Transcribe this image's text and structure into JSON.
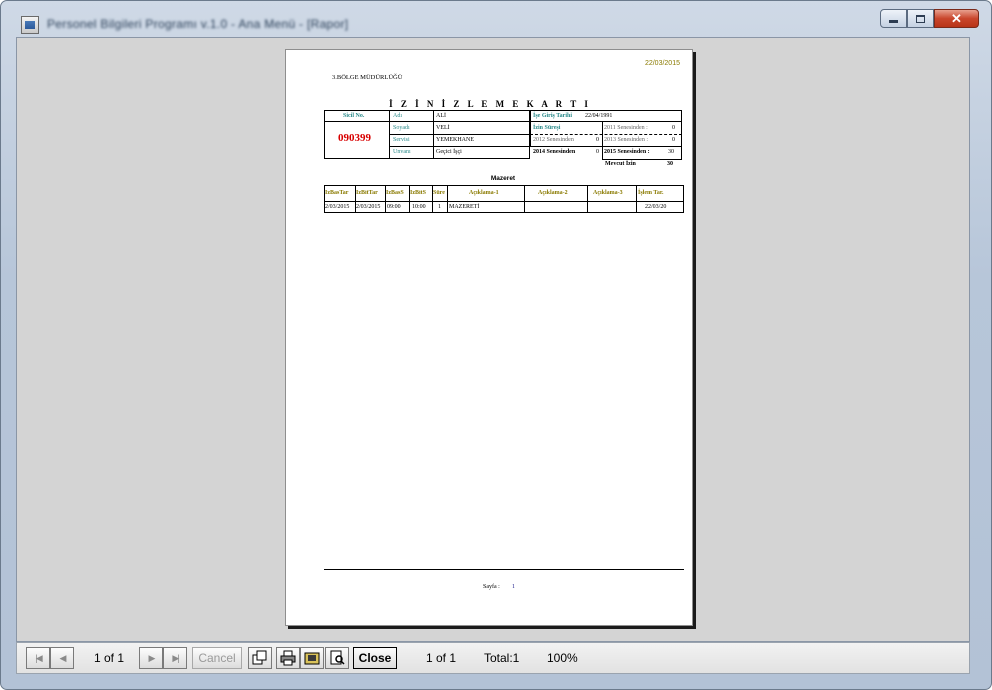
{
  "window": {
    "title": "Personel Bilgileri Programı v.1.0 - Ana Menü - [Rapor]",
    "controls": {
      "minimize": "minimize",
      "maximize": "maximize",
      "close": "✕"
    }
  },
  "report": {
    "date": "22/03/2015",
    "org": "3.BÖLGE MÜDÜRLÜĞÜ",
    "title": "İ Z İ N   İ Z L E M E   K A R T I",
    "card": {
      "sicil_label": "Sicil No.",
      "sicil_value": "090399",
      "adi_label": "Adı",
      "adi_value": "ALİ",
      "soyadi_label": "Soyadı",
      "soyadi_value": "VELİ",
      "servisi_label": "Servisi",
      "servisi_value": "YEMEKHANE",
      "unvani_label": "Unvanı",
      "unvani_value": "Geçici İşçi",
      "ise_giris_label": "İşe Giriş Tarihi",
      "ise_giris_value": "22/04/1991",
      "izin_suresi_label": "İzin Süreşi",
      "y2011_label": "2011 Senesinden :",
      "y2011_value": "0",
      "y2012_label": "2012 Senesinden",
      "y2012_value": "0",
      "y2013_label": "2013 Senesinden :",
      "y2013_value": "0",
      "y2014_label": "2014 Senesinden",
      "y2014_value": "0",
      "y2015_label": "2015 Senesinden :",
      "y2015_value": "30",
      "mevcut_label": "Mevcut  İzin",
      "mevcut_value": "30"
    },
    "mazeret": {
      "title": "Mazeret",
      "headers": [
        "IzBasTar",
        "IzBitTar",
        "IzBasS",
        "IzBitS",
        "Süre",
        "Açıklama-1",
        "Açıklama-2",
        "Açıklama-3",
        "İşlem Tar."
      ],
      "row": [
        "2/03/2015",
        "2/03/2015",
        "09:00",
        "10:00",
        "1",
        "MAZERETİ",
        "",
        "",
        "22/03/20"
      ]
    },
    "footer": {
      "page_label": "Sayfa :",
      "page_num": "1"
    }
  },
  "toolbar": {
    "page_indicator": "1 of 1",
    "cancel_label": "Cancel",
    "close_label": "Close",
    "page_status": "1 of 1",
    "total": "Total:1",
    "zoom": "100%"
  }
}
